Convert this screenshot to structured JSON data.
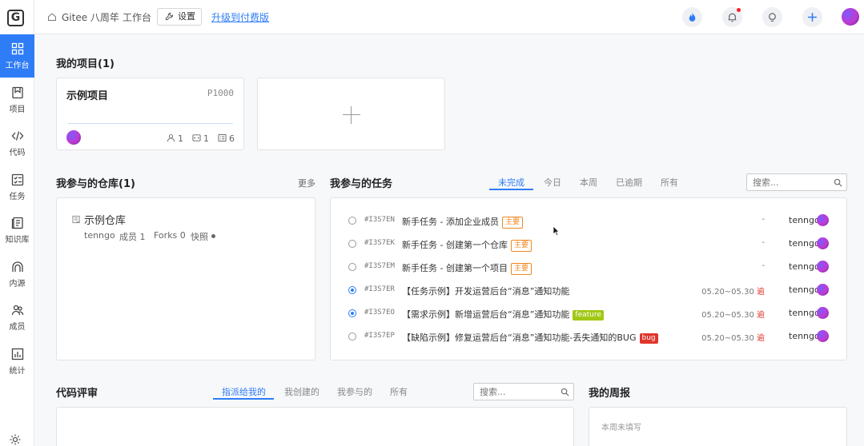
{
  "header": {
    "breadcrumb_org": "Gitee 八周年",
    "breadcrumb_sep": "/",
    "breadcrumb_page": "工作台",
    "settings_label": "设置",
    "upgrade_label": "升级到付费版",
    "icons": [
      "flame-icon",
      "bell-icon",
      "lightbulb-icon",
      "plus-icon",
      "avatar"
    ]
  },
  "sidebar": {
    "logo": "G",
    "items": [
      {
        "label": "工作台",
        "icon": "dashboard-icon",
        "active": true
      },
      {
        "label": "项目",
        "icon": "project-icon"
      },
      {
        "label": "代码",
        "icon": "code-icon"
      },
      {
        "label": "任务",
        "icon": "task-icon"
      },
      {
        "label": "知识库",
        "icon": "book-icon"
      },
      {
        "label": "内源",
        "icon": "innersource-icon"
      },
      {
        "label": "成员",
        "icon": "members-icon"
      },
      {
        "label": "统计",
        "icon": "stats-icon"
      }
    ]
  },
  "projects": {
    "title": "我的项目(1)",
    "items": [
      {
        "name": "示例项目",
        "code": "P1000",
        "members": "1",
        "repos": "1",
        "tasks": "6"
      }
    ]
  },
  "repos": {
    "title": "我参与的仓库(1)",
    "more": "更多",
    "items": [
      {
        "name": "示例仓库",
        "owner": "tenngo",
        "members": "成员 1",
        "forks": "Forks 0",
        "snapshot": "快照"
      }
    ]
  },
  "tasks": {
    "title": "我参与的任务",
    "tabs": [
      "未完成",
      "今日",
      "本周",
      "已逾期",
      "所有"
    ],
    "active_tab": "未完成",
    "search_placeholder": "搜索...",
    "rows": [
      {
        "id": "#I3S7EN",
        "title": "新手任务 - 添加企业成员",
        "tag": "主要",
        "tag_style": "orange",
        "date": "-",
        "late": "",
        "user": "tenngo",
        "status": "todo"
      },
      {
        "id": "#I3S7EK",
        "title": "新手任务 - 创建第一个仓库",
        "tag": "主要",
        "tag_style": "orange",
        "date": "-",
        "late": "",
        "user": "tenngo",
        "status": "todo"
      },
      {
        "id": "#I3S7EM",
        "title": "新手任务 - 创建第一个项目",
        "tag": "主要",
        "tag_style": "orange",
        "date": "-",
        "late": "",
        "user": "tenngo",
        "status": "todo"
      },
      {
        "id": "#I3S7ER",
        "title": "【任务示例】开发运营后台“消息”通知功能",
        "tag": "",
        "tag_style": "",
        "date": "05.20~05.30",
        "late": "逾",
        "user": "tenngo",
        "status": "progress"
      },
      {
        "id": "#I3S7EO",
        "title": "【需求示例】新增运营后台“消息”通知功能",
        "tag": "feature",
        "tag_style": "green",
        "date": "05.20~05.30",
        "late": "逾",
        "user": "tenngo",
        "status": "progress"
      },
      {
        "id": "#I3S7EP",
        "title": "【缺陷示例】修复运营后台“消息”通知功能-丢失通知的BUG",
        "tag": "bug",
        "tag_style": "red",
        "date": "05.20~05.30",
        "late": "逾",
        "user": "tenngo",
        "status": "todo"
      }
    ]
  },
  "review": {
    "title": "代码评审",
    "tabs": [
      "指派给我的",
      "我创建的",
      "我参与的",
      "所有"
    ],
    "active_tab": "指派给我的",
    "search_placeholder": "搜索..."
  },
  "weekly": {
    "title": "我的周报",
    "empty": "本周未填写"
  },
  "colors": {
    "accent": "#2e7cf6",
    "late": "#e0352b",
    "tag_major": "#f08a24",
    "tag_feature": "#a0c814",
    "tag_bug": "#e0352b"
  }
}
